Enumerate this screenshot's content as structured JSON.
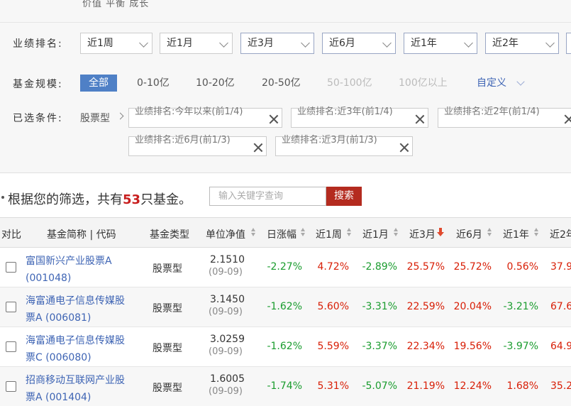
{
  "top_partial_text": "价值  平衡  成长",
  "filters": {
    "performance_label": "业绩排名:",
    "performance_options": [
      "近1周",
      "近1月",
      "近3月",
      "近6月",
      "近1年",
      "近2年"
    ],
    "size_label": "基金规模:",
    "size_options": [
      "全部",
      "0-10亿",
      "10-20亿",
      "20-50亿",
      "50-100亿",
      "100亿以上"
    ],
    "size_custom": "自定义",
    "selected_label": "已选条件:",
    "selected_type": "股票型",
    "chips": [
      "业绩排名:今年以来(前1/4)",
      "业绩排名:近3年(前1/4)",
      "业绩排名:近2年(前1/4)",
      "业绩排名:近6月(前1/3)",
      "业绩排名:近3月(前1/3)"
    ]
  },
  "results": {
    "prefix": "根据您的筛选，共有",
    "count": "53",
    "suffix": "只基金。",
    "search_placeholder": "输入关键字查询",
    "search_button": "搜索"
  },
  "table": {
    "headers": {
      "compare": "对比",
      "name": "基金简称 | 代码",
      "type": "基金类型",
      "nav": "单位净值",
      "daily": "日涨幅",
      "w1": "近1周",
      "m1": "近1月",
      "m3": "近3月",
      "m6": "近6月",
      "y1": "近1年",
      "y2": "近2年"
    },
    "rows": [
      {
        "name": "富国新兴产业股票A (001048)",
        "type": "股票型",
        "nav": "2.1510",
        "date": "(09-09)",
        "daily": "-2.27%",
        "w1": "4.72%",
        "m1": "-2.89%",
        "m3": "25.57%",
        "m6": "25.72%",
        "y1": "0.56%",
        "y2": "37.9"
      },
      {
        "name": "海富通电子信息传媒股票A (006081)",
        "type": "股票型",
        "nav": "3.1450",
        "date": "(09-09)",
        "daily": "-1.62%",
        "w1": "5.60%",
        "m1": "-3.31%",
        "m3": "22.59%",
        "m6": "20.04%",
        "y1": "-3.21%",
        "y2": "67.6"
      },
      {
        "name": "海富通电子信息传媒股票C (006080)",
        "type": "股票型",
        "nav": "3.0259",
        "date": "(09-09)",
        "daily": "-1.62%",
        "w1": "5.59%",
        "m1": "-3.37%",
        "m3": "22.34%",
        "m6": "19.56%",
        "y1": "-3.97%",
        "y2": "64.9"
      },
      {
        "name": "招商移动互联网产业股票A (001404)",
        "type": "股票型",
        "nav": "1.6005",
        "date": "(09-09)",
        "daily": "-1.74%",
        "w1": "5.31%",
        "m1": "-5.07%",
        "m3": "21.19%",
        "m6": "12.24%",
        "y1": "1.68%",
        "y2": "35.2"
      }
    ]
  },
  "colors": {
    "positive": "#d81e06",
    "negative": "#1a9c2e",
    "link": "#3e64b4",
    "active": "#4f80c6",
    "button": "#b42b1f"
  }
}
